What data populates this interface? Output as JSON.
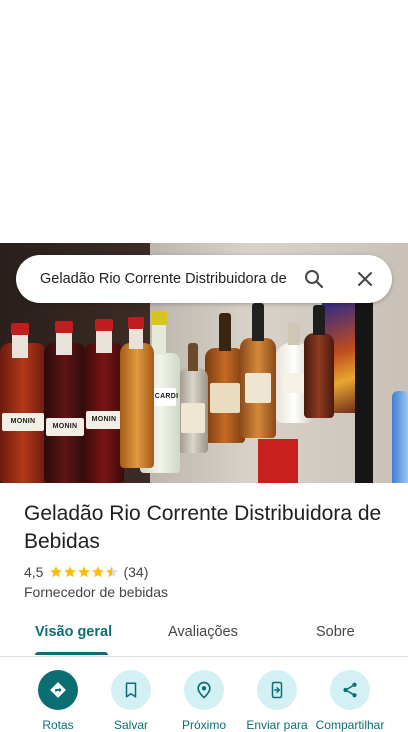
{
  "search": {
    "query": "Geladão Rio Corrente Distribuidora de Bebidas"
  },
  "place": {
    "name": "Geladão Rio Corrente Distribuidora de Bebidas",
    "rating": "4,5",
    "rating_stars": 4.5,
    "review_count": "(34)",
    "category": "Fornecedor de bebidas"
  },
  "photo": {
    "bottle_labels": [
      "MONIN",
      "MONIN",
      "MONIN",
      "BACARDI"
    ]
  },
  "tabs": [
    {
      "label": "Visão geral",
      "active": true
    },
    {
      "label": "Avaliações",
      "active": false
    },
    {
      "label": "Sobre",
      "active": false
    }
  ],
  "actions": [
    {
      "label": "Rotas",
      "icon": "directions-icon"
    },
    {
      "label": "Salvar",
      "icon": "bookmark-icon"
    },
    {
      "label": "Próximo",
      "icon": "nearby-icon"
    },
    {
      "label": "Enviar para",
      "icon": "send-to-phone-icon"
    },
    {
      "label": "Compartilhar",
      "icon": "share-icon"
    }
  ],
  "colors": {
    "accent": "#0b6e73",
    "accent_light": "#d3f0f4",
    "star": "#fbbc04"
  }
}
